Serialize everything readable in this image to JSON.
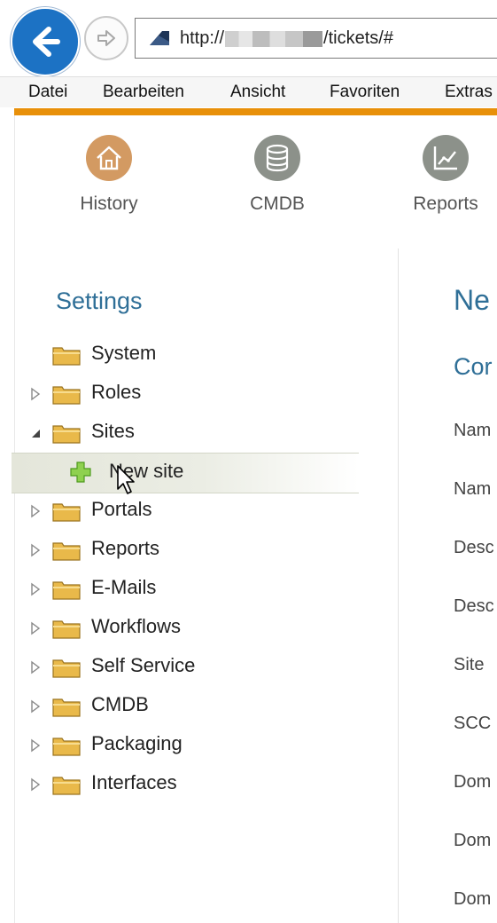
{
  "browser": {
    "url_prefix": "http://",
    "url_suffix": "/tickets/#"
  },
  "menubar": {
    "items": [
      "Datei",
      "Bearbeiten",
      "Ansicht",
      "Favoriten",
      "Extras"
    ]
  },
  "colors": {
    "accent": "#e8900a",
    "heading": "#2f6f97",
    "nav_history": "#d39a62",
    "nav_cmdb": "#8c918a",
    "nav_reports": "#8c918a"
  },
  "nav": [
    {
      "label": "History",
      "icon": "house-icon"
    },
    {
      "label": "CMDB",
      "icon": "database-icon"
    },
    {
      "label": "Reports",
      "icon": "chart-icon"
    }
  ],
  "settings": {
    "title": "Settings",
    "tree": [
      {
        "label": "System",
        "arrow": "none"
      },
      {
        "label": "Roles",
        "arrow": "collapsed"
      },
      {
        "label": "Sites",
        "arrow": "expanded"
      },
      {
        "label": "New site",
        "child": true,
        "selected": true,
        "icon": "plus-icon"
      },
      {
        "label": "Portals",
        "arrow": "collapsed"
      },
      {
        "label": "Reports",
        "arrow": "collapsed"
      },
      {
        "label": "E-Mails",
        "arrow": "collapsed"
      },
      {
        "label": "Workflows",
        "arrow": "collapsed"
      },
      {
        "label": "Self Service",
        "arrow": "collapsed"
      },
      {
        "label": "CMDB",
        "arrow": "collapsed"
      },
      {
        "label": "Packaging",
        "arrow": "collapsed"
      },
      {
        "label": "Interfaces",
        "arrow": "collapsed"
      }
    ]
  },
  "content": {
    "title": "Ne",
    "section": "Cor",
    "fields": [
      "Nam",
      "Nam",
      "Desc",
      "Desc",
      "Site",
      "SCC",
      "Dom",
      "Dom",
      "Dom"
    ]
  }
}
